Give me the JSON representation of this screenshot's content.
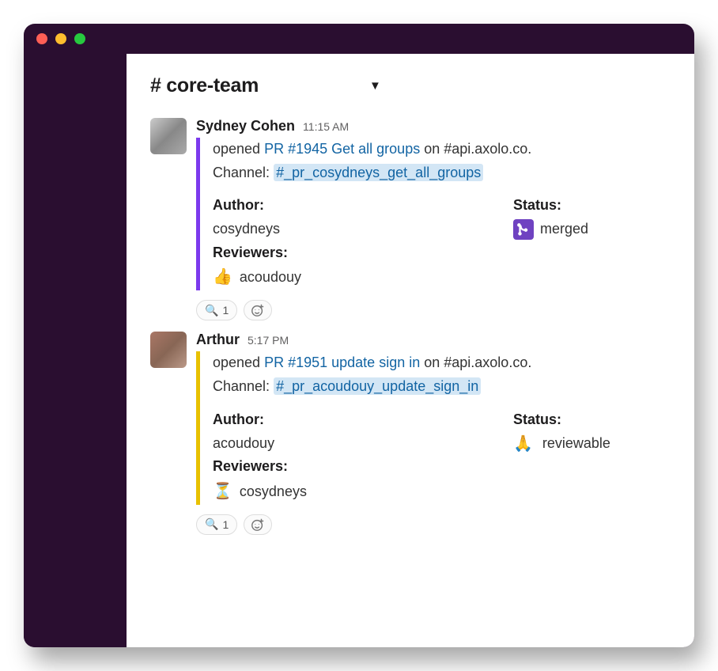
{
  "channel": {
    "name": "# core-team"
  },
  "messages": [
    {
      "author": "Sydney Cohen",
      "time": "11:15 AM",
      "bar_color": "purple",
      "opened_prefix": "opened ",
      "pr_link": "PR #1945 Get all groups",
      "opened_middle": " on #api.axolo.co.",
      "channel_label": "Channel: ",
      "channel_link": "#_pr_cosydneys_get_all_groups",
      "author_label": "Author:",
      "author_value": "cosydneys",
      "reviewers_label": "Reviewers:",
      "reviewer_emoji": "👍",
      "reviewer_name": " acoudouy",
      "status_label": "Status:",
      "status_text": "merged",
      "status_icon": "merged",
      "reaction_emoji": "🔍",
      "reaction_count": "1"
    },
    {
      "author": "Arthur",
      "time": "5:17 PM",
      "bar_color": "yellow",
      "opened_prefix": "opened ",
      "pr_link": "PR #1951 update sign in",
      "opened_middle": " on #api.axolo.co.",
      "channel_label": "Channel: ",
      "channel_link": "#_pr_acoudouy_update_sign_in",
      "author_label": "Author:",
      "author_value": "acoudouy",
      "reviewers_label": "Reviewers:",
      "reviewer_emoji": "⏳",
      "reviewer_name": " cosydneys",
      "status_label": "Status:",
      "status_text": "reviewable",
      "status_icon": "pray",
      "reaction_emoji": "🔍",
      "reaction_count": "1"
    }
  ]
}
